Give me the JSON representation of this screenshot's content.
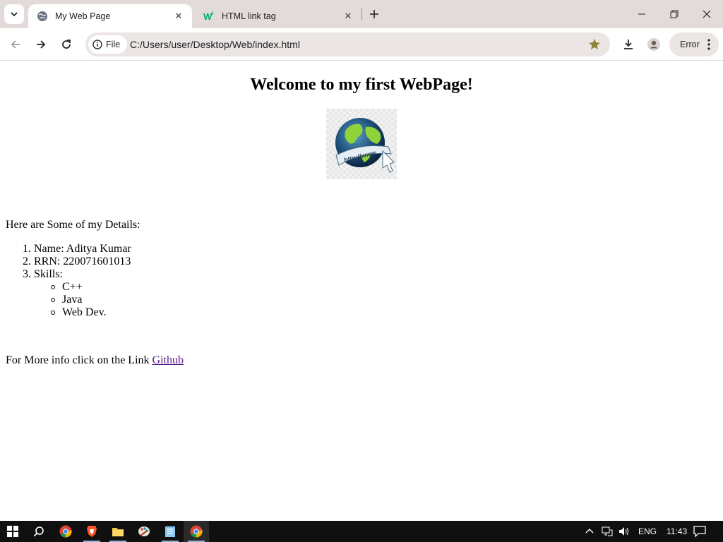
{
  "browser": {
    "tabs": [
      {
        "label": "My Web Page",
        "favicon": "globe-icon",
        "active": true
      },
      {
        "label": "HTML link tag",
        "favicon": "w3schools-icon",
        "active": false
      }
    ],
    "site_chip_label": "File",
    "url": "C:/Users/user/Desktop/Web/index.html",
    "error_label": "Error",
    "accent": "#e3dbda"
  },
  "page": {
    "heading": "Welcome to my first WebPage!",
    "image_alt": "www globe",
    "intro": "Here are Some of my Details:",
    "details": [
      {
        "num": "1.",
        "text": "Name: Aditya Kumar"
      },
      {
        "num": "2.",
        "text": "RRN: 220071601013"
      },
      {
        "num": "3.",
        "text": "Skills:"
      }
    ],
    "skills": [
      "C++",
      "Java",
      "Web Dev."
    ],
    "more_text": "For More info click on the Link",
    "link_text": "Github",
    "link_color": "#551a8b"
  },
  "taskbar": {
    "apps": [
      "windows-start-icon",
      "search-icon",
      "chrome-icon",
      "brave-icon",
      "file-explorer-icon",
      "paint-icon",
      "notepad-icon",
      "chrome-active-icon"
    ],
    "language": "ENG",
    "time": "11:43"
  }
}
